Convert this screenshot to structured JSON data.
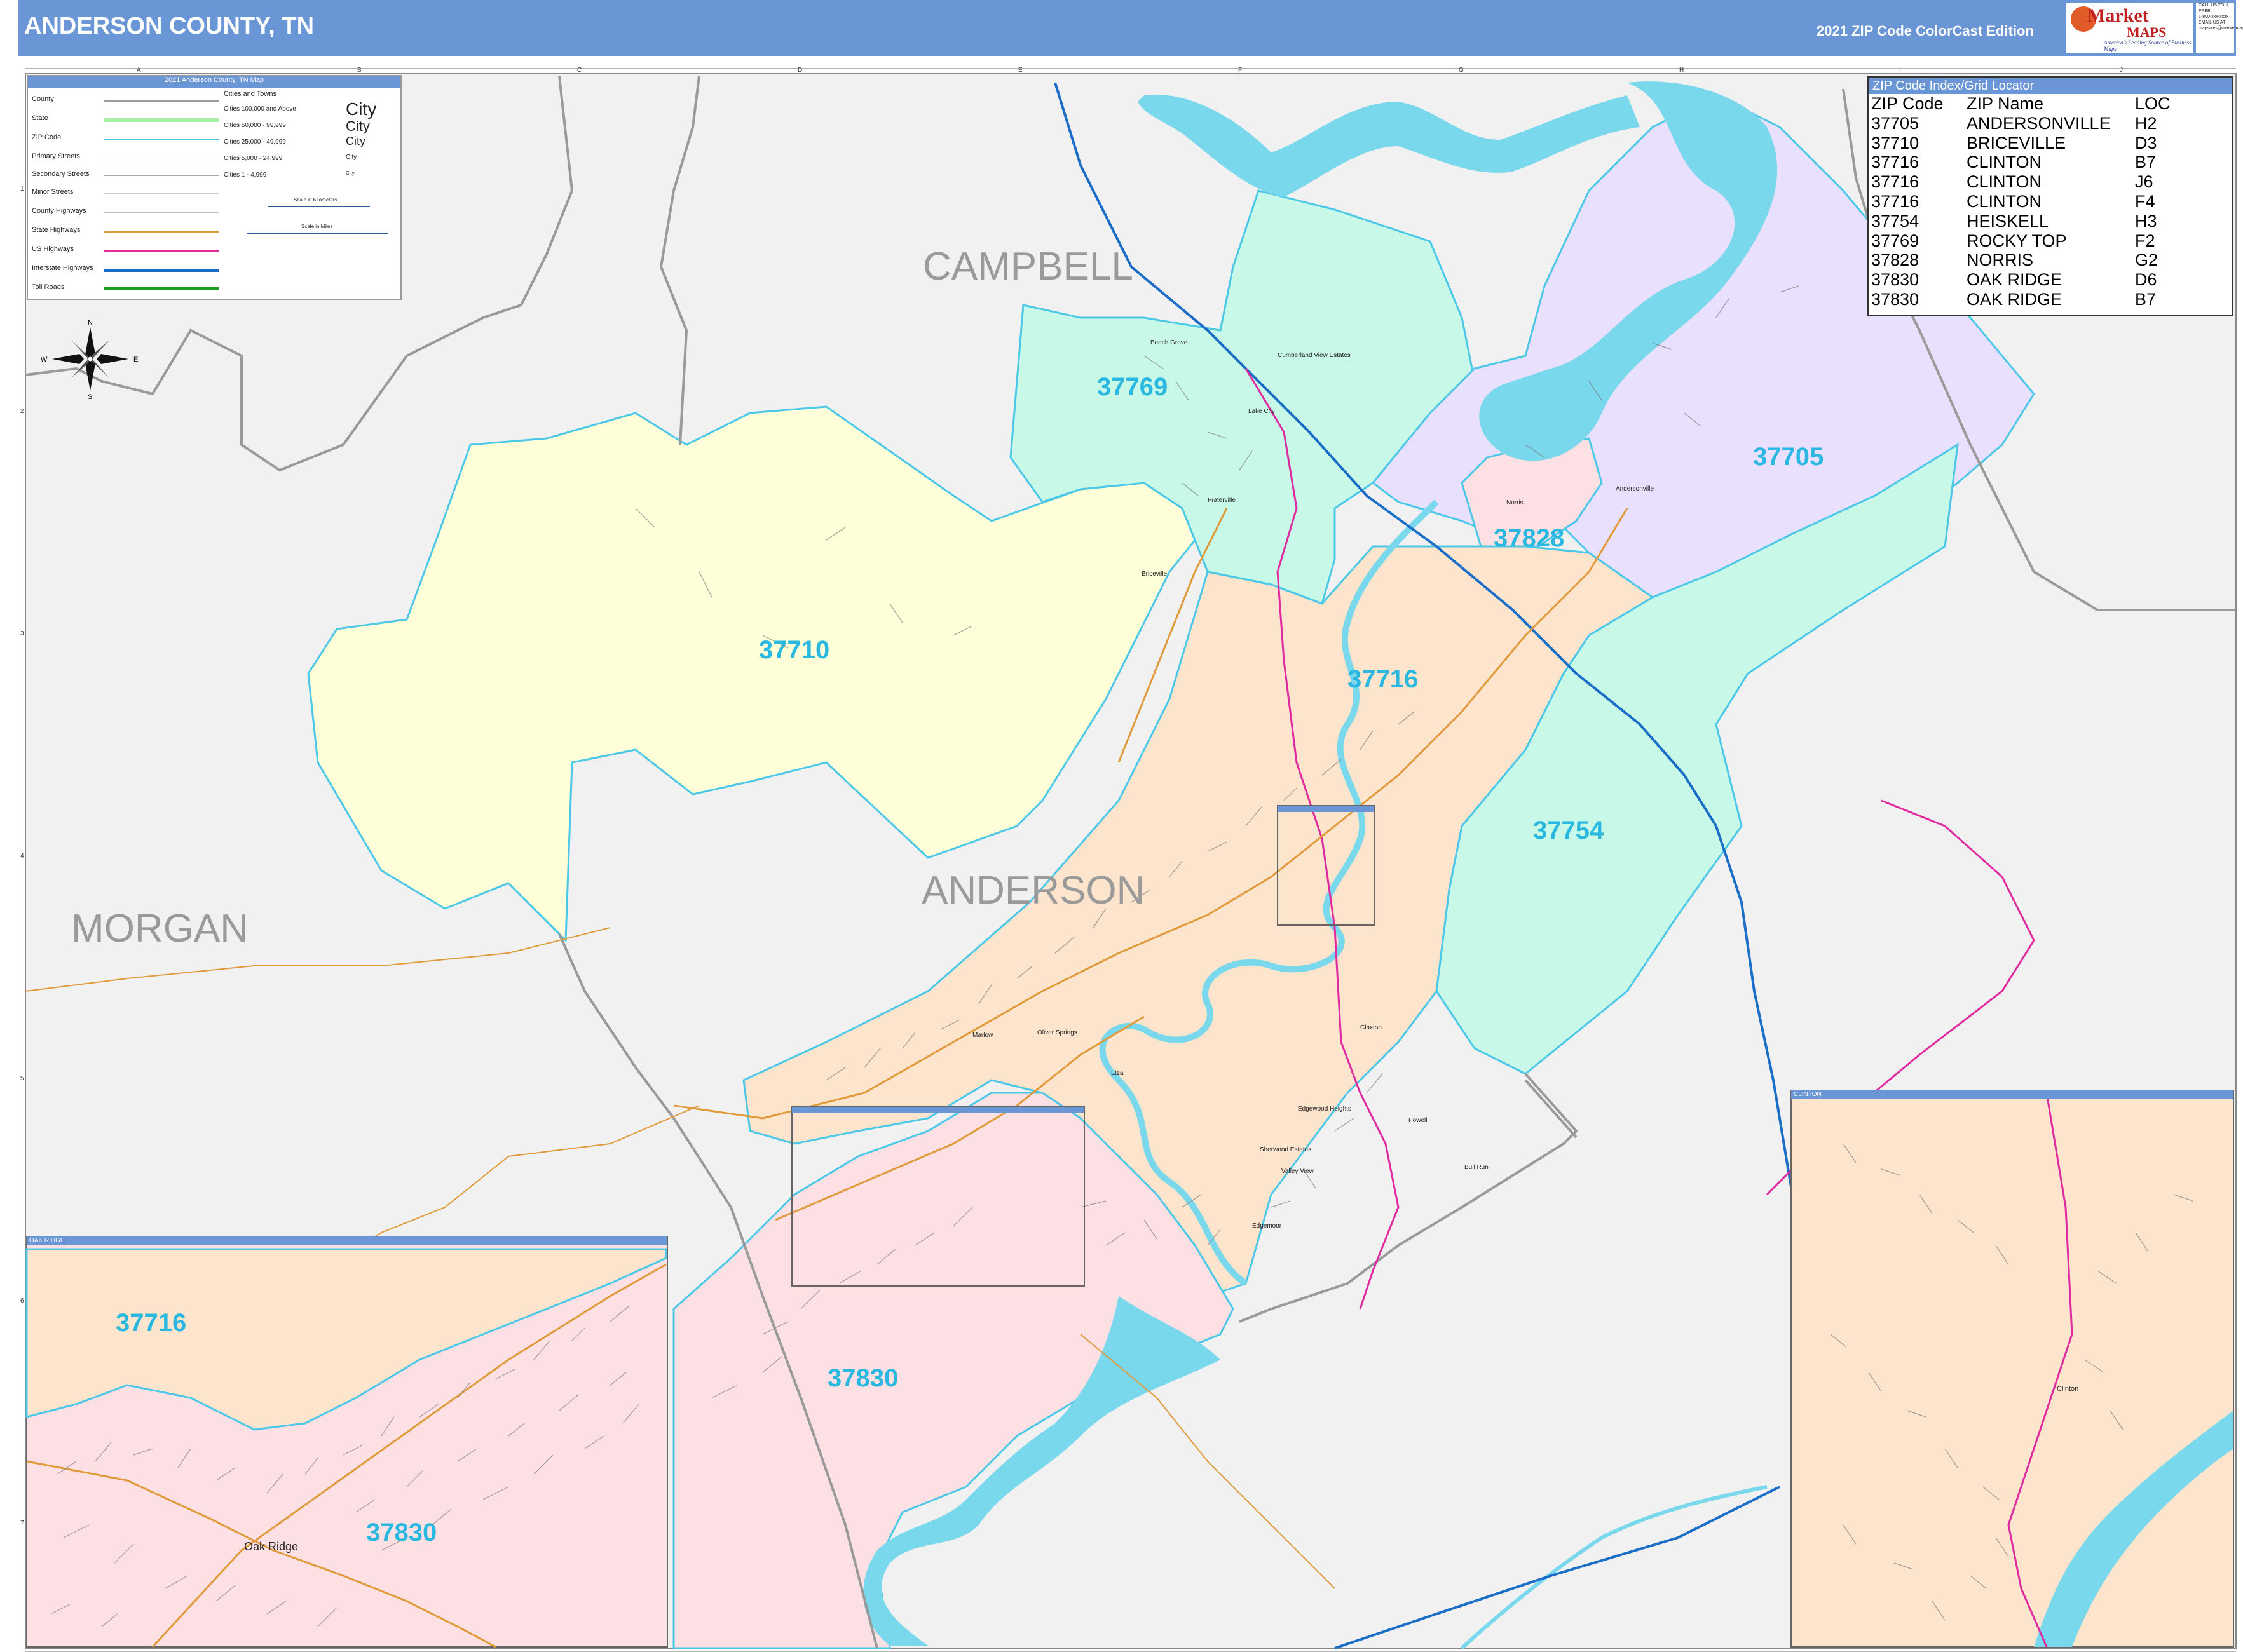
{
  "header": {
    "title": "ANDERSON COUNTY, TN",
    "edition": "2021 ZIP Code ColorCast Edition",
    "logo_brand_top": "Market",
    "logo_brand_bottom": "MAPS",
    "logo_tagline": "America's Leading Source of Business Maps",
    "contact_lines": [
      "CALL US TOLL FREE",
      "1-800-xxx-xxxx",
      "EMAIL US AT",
      "mapsales@marketmaps.com"
    ]
  },
  "legend": {
    "title": "2021 Anderson County, TN Map",
    "line_items": [
      "County",
      "State",
      "ZIP Code",
      "Primary Streets",
      "Secondary Streets",
      "Minor Streets",
      "County Highways",
      "State Highways",
      "US Highways",
      "Interstate Highways",
      "Toll Roads"
    ],
    "cities_header": "Cities and Towns",
    "city_classes": [
      "Cities 100,000 and Above",
      "Cities 50,000 - 99,999",
      "Cities 25,000 - 49,999",
      "Cities 5,000 - 24,999",
      "Cities 1 - 4,999"
    ],
    "city_samples": [
      "City",
      "City",
      "City",
      "City",
      "City"
    ],
    "scale_km": "Scale in Kilometers",
    "scale_mi": "Scale in Miles",
    "colors": {
      "county": "#9a9a9a",
      "state": "#a8f0a8",
      "zip": "#4bc8e8",
      "state_hwy": "#e09a3a",
      "us_hwy": "#e02aa0",
      "interstate": "#1a6ec8",
      "toll": "#1aa01a"
    }
  },
  "compass": {
    "n": "N",
    "s": "S",
    "e": "E",
    "w": "W"
  },
  "index": {
    "title": "ZIP Code Index/Grid Locator",
    "columns": [
      "ZIP Code",
      "ZIP Name",
      "LOC"
    ],
    "rows": [
      [
        "37705",
        "ANDERSONVILLE",
        "H2"
      ],
      [
        "37710",
        "BRICEVILLE",
        "D3"
      ],
      [
        "37716",
        "CLINTON",
        "B7"
      ],
      [
        "37716",
        "CLINTON",
        "J6"
      ],
      [
        "37716",
        "CLINTON",
        "F4"
      ],
      [
        "37754",
        "HEISKELL",
        "H3"
      ],
      [
        "37769",
        "ROCKY TOP",
        "F2"
      ],
      [
        "37828",
        "NORRIS",
        "G2"
      ],
      [
        "37830",
        "OAK RIDGE",
        "D6"
      ],
      [
        "37830",
        "OAK RIDGE",
        "B7"
      ]
    ]
  },
  "counties": {
    "campbell": "CAMPBELL",
    "anderson": "ANDERSON",
    "morgan": "MORGAN"
  },
  "zips": {
    "z37769": "37769",
    "z37705": "37705",
    "z37710": "37710",
    "z37828": "37828",
    "z37716": "37716",
    "z37754": "37754",
    "z37830": "37830"
  },
  "places": {
    "beech_grove": "Beech Grove",
    "cumberland_view": "Cumberland View Estates",
    "lake_city": "Lake City",
    "fraterville": "Fraterville",
    "briceville": "Briceville",
    "norris": "Norris",
    "andersonville": "Andersonville",
    "clinton": "Clinton",
    "oak_ridge": "Oak Ridge",
    "marlow": "Marlow",
    "oliver_springs": "Oliver Springs",
    "edgewood_heights": "Edgewood Heights",
    "sherwood_estates": "Sherwood Estates",
    "valley_view": "Valley View",
    "edgemoor": "Edgemoor",
    "bull_run": "Bull Run",
    "elza": "Elza",
    "claxton": "Claxton",
    "powell": "Powell"
  },
  "insets": {
    "oak_ridge_title": "OAK RIDGE",
    "clinton_title": "CLINTON",
    "oak_ridge_zip_a": "37716",
    "oak_ridge_zip_b": "37830",
    "oak_ridge_city": "Oak Ridge",
    "clinton_city": "Clinton"
  },
  "grid": {
    "columns": [
      "A",
      "B",
      "C",
      "D",
      "E",
      "F",
      "G",
      "H",
      "I",
      "J"
    ],
    "rows": [
      "1",
      "2",
      "3",
      "4",
      "5",
      "6",
      "7"
    ]
  },
  "zip_colors": {
    "z37769": "#c8f8e8",
    "z37705": "#e8e0fc",
    "z37710": "#fefed8",
    "z37828": "#fde0e4",
    "z37716": "#fde4cc",
    "z37754": "#c8f8e8",
    "z37830": "#fde0e4",
    "unzipped": "#f1f1f1",
    "water": "#7ad8ec"
  }
}
